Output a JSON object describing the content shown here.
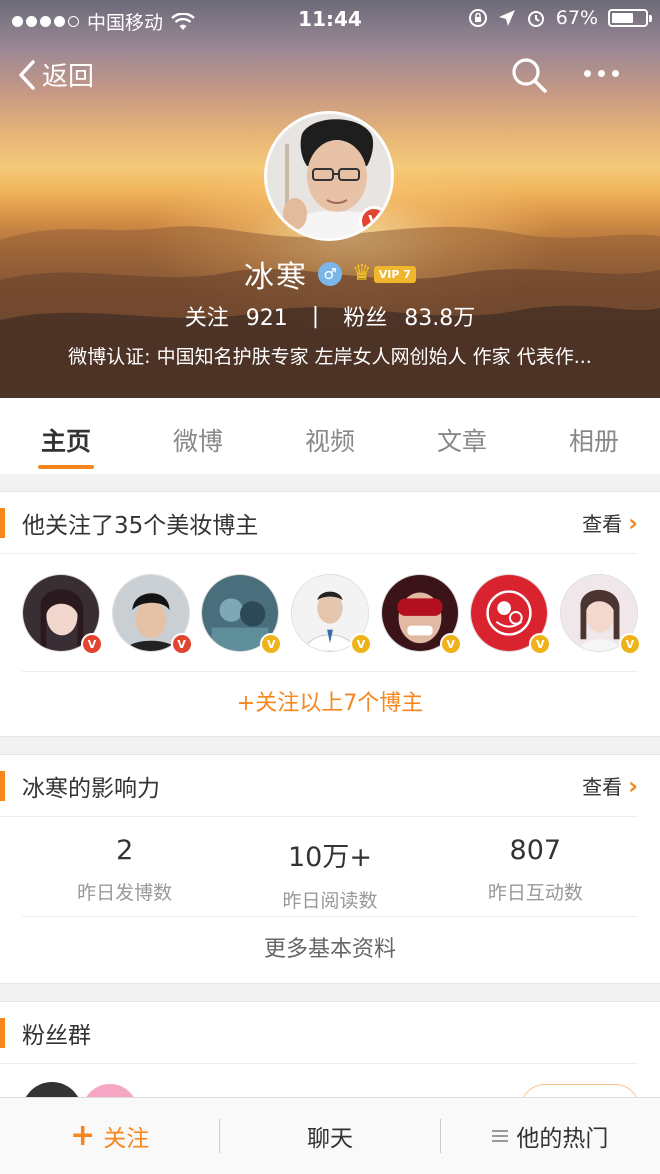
{
  "status_bar": {
    "carrier": "中国移动",
    "time": "11:44",
    "battery": "67%",
    "battery_level": 0.67
  },
  "nav": {
    "back_label": "返回"
  },
  "profile": {
    "name": "冰寒",
    "vip_label": "VIP 7",
    "following_label": "关注",
    "following_count": "921",
    "separator": "|",
    "fans_label": "粉丝",
    "fans_count": "83.8万",
    "verification": "微博认证: 中国知名护肤专家 左岸女人网创始人 作家 代表作..."
  },
  "tabs": [
    {
      "label": "主页",
      "active": true
    },
    {
      "label": "微博",
      "active": false
    },
    {
      "label": "视频",
      "active": false
    },
    {
      "label": "文章",
      "active": false
    },
    {
      "label": "相册",
      "active": false
    }
  ],
  "beauty_card": {
    "title": "他关注了35个美妆博主",
    "more_label": "查看",
    "follow_all_label": "+关注以上7个博主",
    "bloggers": [
      {
        "badge": "red"
      },
      {
        "badge": "red"
      },
      {
        "badge": "gold"
      },
      {
        "badge": "gold"
      },
      {
        "badge": "gold"
      },
      {
        "badge": "gold"
      },
      {
        "badge": "gold"
      }
    ]
  },
  "influence_card": {
    "title": "冰寒的影响力",
    "more_label": "查看",
    "stats": [
      {
        "value": "2",
        "label": "昨日发博数"
      },
      {
        "value": "10万+",
        "label": "昨日阅读数"
      },
      {
        "value": "807",
        "label": "昨日互动数"
      }
    ],
    "more_info_label": "更多基本资料"
  },
  "fans_card": {
    "title": "粉丝群"
  },
  "bottom_bar": {
    "follow_label": "关注",
    "chat_label": "聊天",
    "hot_label": "他的热门"
  },
  "colors": {
    "accent": "#f7871c",
    "verified_red": "#e2452f",
    "verified_gold": "#f0b21a"
  }
}
